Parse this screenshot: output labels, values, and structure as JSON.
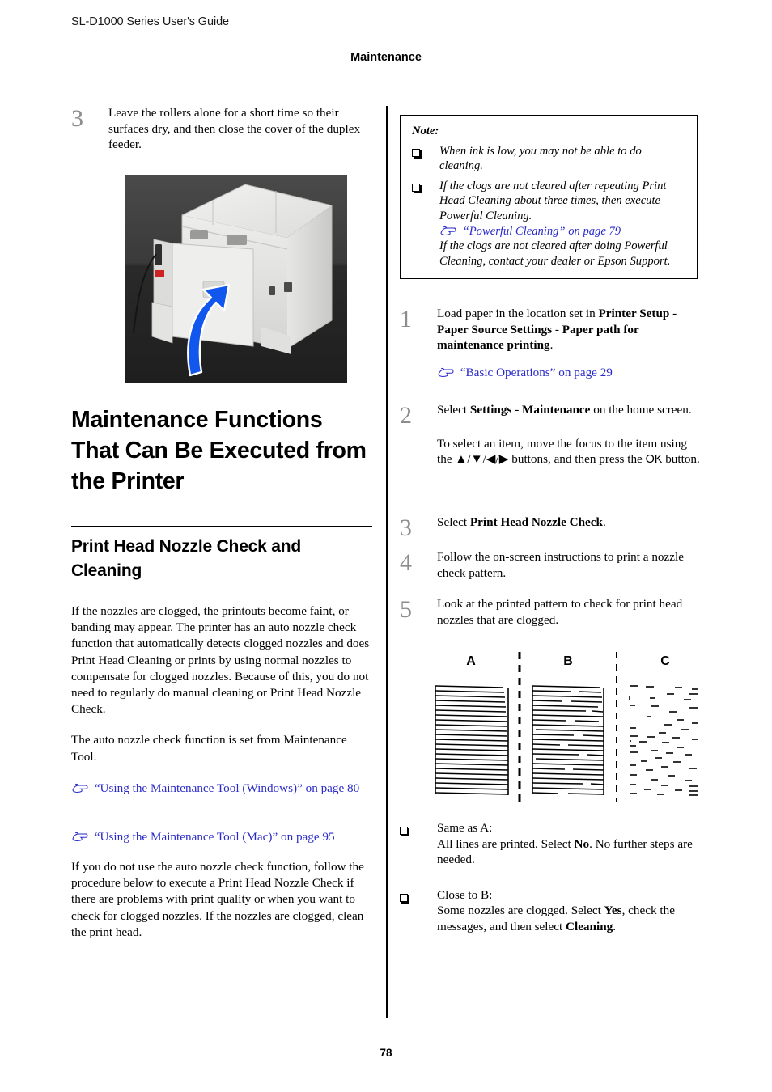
{
  "header": {
    "guide_title": "SL-D1000 Series User's Guide",
    "chapter": "Maintenance"
  },
  "footer": {
    "page_number": "78"
  },
  "colors": {
    "link": "#2a2aca",
    "step_number": "#8c8c8c",
    "text": "#000000",
    "arrow_highlight": "#1155ee"
  },
  "left_column": {
    "step3": {
      "number": "3",
      "text": "Leave the rollers alone for a short time so their surfaces dry, and then close the cover of the duplex feeder."
    },
    "figure_caption": "Printer rear view with duplex feeder cover and blue upward arrow",
    "heading1": "Maintenance Functions That Can Be Executed from the Printer",
    "heading2": "Print Head Nozzle Check and Cleaning",
    "para1": "If the nozzles are clogged, the printouts become faint, or banding may appear. The printer has an auto nozzle check function that automatically detects clogged nozzles and does Print Head Cleaning or prints by using normal nozzles to compensate for clogged nozzles. Because of this, you do not need to regularly do manual cleaning or Print Head Nozzle Check.",
    "para2": "The auto nozzle check function is set from Maintenance Tool.",
    "link1": "“Using the Maintenance Tool (Windows)” on page 80",
    "link2": "“Using the Maintenance Tool (Mac)” on page 95",
    "para3": "If you do not use the auto nozzle check function, follow the procedure below to execute a Print Head Nozzle Check if there are problems with print quality or when you want to check for clogged nozzles. If the nozzles are clogged, clean the print head."
  },
  "right_column": {
    "note": {
      "title": "Note:",
      "item1": "When ink is low, you may not be able to do cleaning.",
      "item2_p1": "If the clogs are not cleared after repeating Print Head Cleaning about three times, then execute Powerful Cleaning.",
      "item2_link": "“Powerful Cleaning” on page 79",
      "item2_p2": "If the clogs are not cleared after doing Powerful Cleaning, contact your dealer or Epson Support."
    },
    "steps": [
      {
        "number": "1",
        "segments": [
          {
            "text": "Load paper in the location set in ",
            "bold": false
          },
          {
            "text": "Printer Setup",
            "bold": true
          },
          {
            "text": " - ",
            "bold": false
          },
          {
            "text": "Paper Source Settings",
            "bold": true
          },
          {
            "text": " - ",
            "bold": false
          },
          {
            "text": "Paper path for maintenance printing",
            "bold": true
          },
          {
            "text": ".",
            "bold": false
          }
        ],
        "link": "“Basic Operations” on page 29"
      },
      {
        "number": "2",
        "segments": [
          {
            "text": "Select ",
            "bold": false
          },
          {
            "text": "Settings",
            "bold": true
          },
          {
            "text": " - ",
            "bold": false
          },
          {
            "text": "Maintenance",
            "bold": true
          },
          {
            "text": " on the home screen.",
            "bold": false
          }
        ],
        "extra_pre": "To select an item, move the focus to the item using the ",
        "extra_keys": "▲/▼/◀/▶",
        "extra_mid": " buttons, and then press the ",
        "extra_ok": "OK",
        "extra_post": " button."
      },
      {
        "number": "3",
        "segments": [
          {
            "text": "Select ",
            "bold": false
          },
          {
            "text": "Print Head Nozzle Check",
            "bold": true
          },
          {
            "text": ".",
            "bold": false
          }
        ]
      },
      {
        "number": "4",
        "segments": [
          {
            "text": "Follow the on-screen instructions to print a nozzle check pattern.",
            "bold": false
          }
        ]
      },
      {
        "number": "5",
        "segments": [
          {
            "text": "Look at the printed pattern to check for print head nozzles that are clogged.",
            "bold": false
          }
        ]
      }
    ],
    "figure": {
      "labels": [
        "A",
        "B",
        "C"
      ],
      "description": "Nozzle check pattern samples: A all lines printed, B some lines broken, C most lines missing"
    },
    "results": [
      {
        "title": "Same as A:",
        "segments": [
          {
            "text": "All lines are printed. Select ",
            "bold": false
          },
          {
            "text": "No",
            "bold": true
          },
          {
            "text": ". No further steps are needed.",
            "bold": false
          }
        ]
      },
      {
        "title": "Close to B:",
        "segments": [
          {
            "text": "Some nozzles are clogged. Select ",
            "bold": false
          },
          {
            "text": "Yes",
            "bold": true
          },
          {
            "text": ", check the messages, and then select ",
            "bold": false
          },
          {
            "text": "Cleaning",
            "bold": true
          },
          {
            "text": ".",
            "bold": false
          }
        ]
      }
    ]
  }
}
